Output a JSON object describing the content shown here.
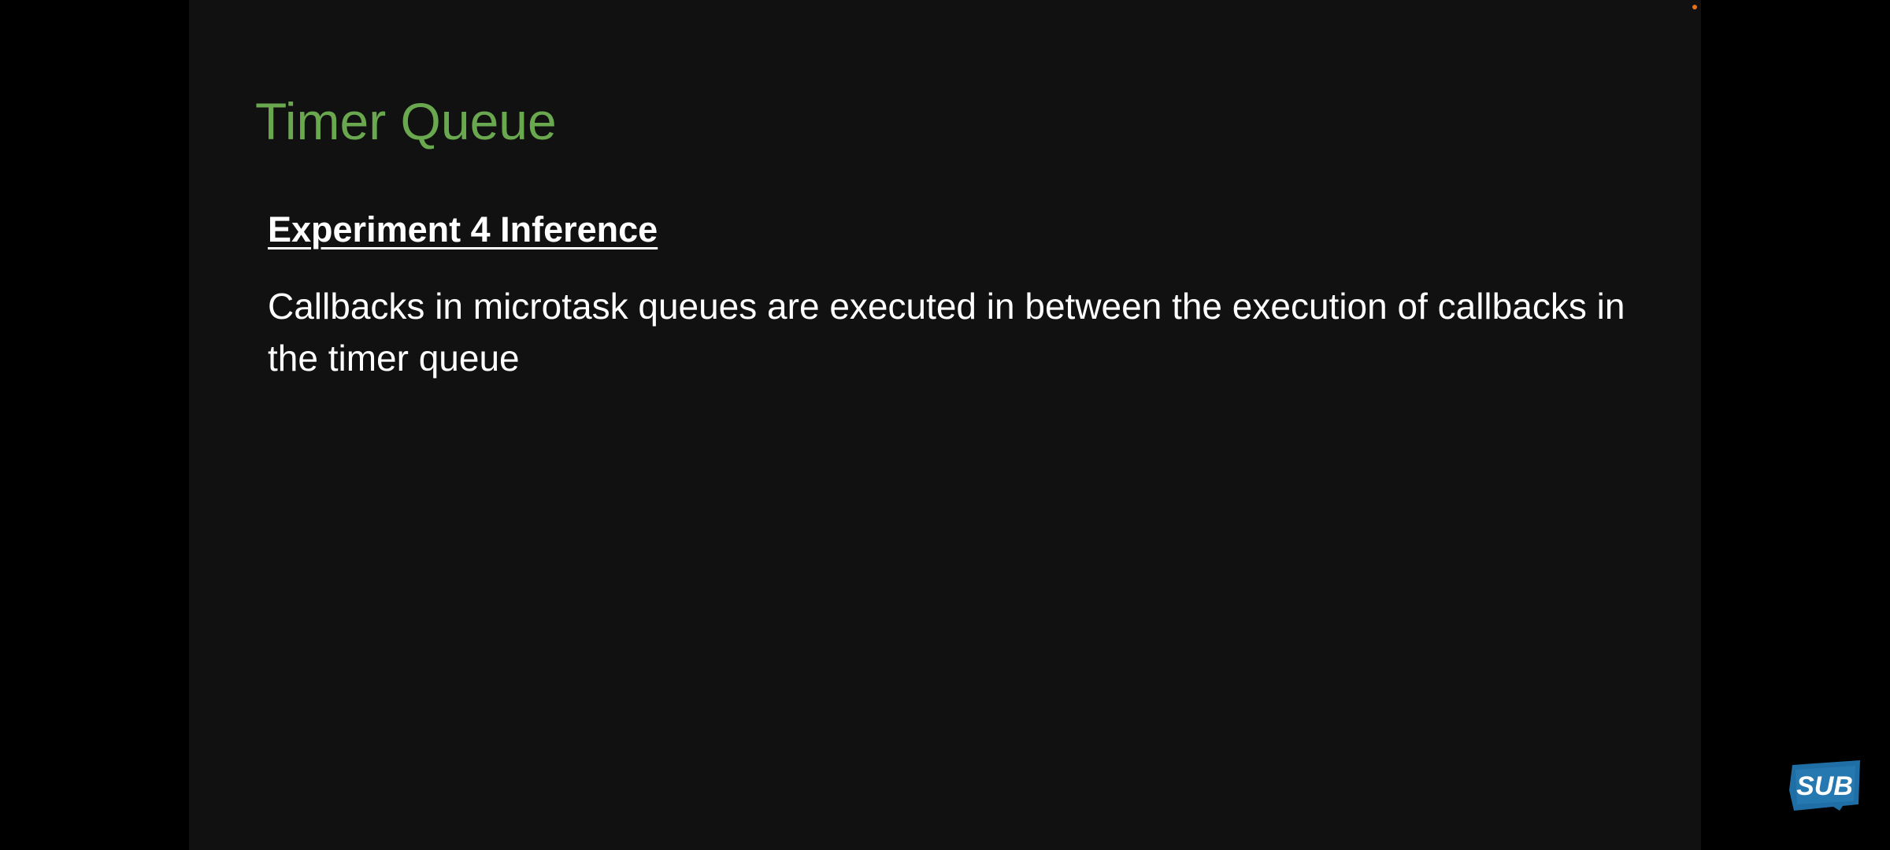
{
  "slide": {
    "title": "Timer Queue",
    "subtitle": "Experiment 4 Inference",
    "body": "Callbacks in microtask queues are executed in between the execution of callbacks in the timer queue"
  },
  "overlay": {
    "sub_badge": "SUB"
  },
  "colors": {
    "title": "#6aa84f",
    "slide_background": "#111111",
    "letterbox": "#000000",
    "text": "#ffffff",
    "sub_badge": "#1f6fa6",
    "record_dot": "#e8711c"
  }
}
